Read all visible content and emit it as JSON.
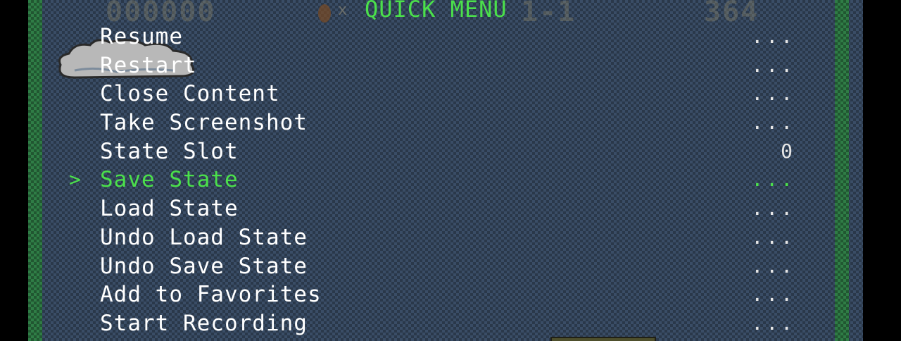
{
  "hud": {
    "score": "000000",
    "coin_multiplier": "x",
    "world": "1-1",
    "time": "364"
  },
  "menu": {
    "title": "QUICK MENU",
    "cursor_symbol": ">",
    "selected_index": 5,
    "items": [
      {
        "label": "Resume",
        "value": "..."
      },
      {
        "label": "Restart",
        "value": "..."
      },
      {
        "label": "Close Content",
        "value": "..."
      },
      {
        "label": "Take Screenshot",
        "value": "..."
      },
      {
        "label": "State Slot",
        "value": "0"
      },
      {
        "label": "Save State",
        "value": "..."
      },
      {
        "label": "Load State",
        "value": "..."
      },
      {
        "label": "Undo Load State",
        "value": "..."
      },
      {
        "label": "Undo Save State",
        "value": "..."
      },
      {
        "label": "Add to Favorites",
        "value": "..."
      },
      {
        "label": "Start Recording",
        "value": "..."
      }
    ]
  },
  "colors": {
    "menu_text": "#ffffff",
    "selected_text": "#4be04b",
    "background": "#3a4d66",
    "border": "#2f7d46"
  }
}
